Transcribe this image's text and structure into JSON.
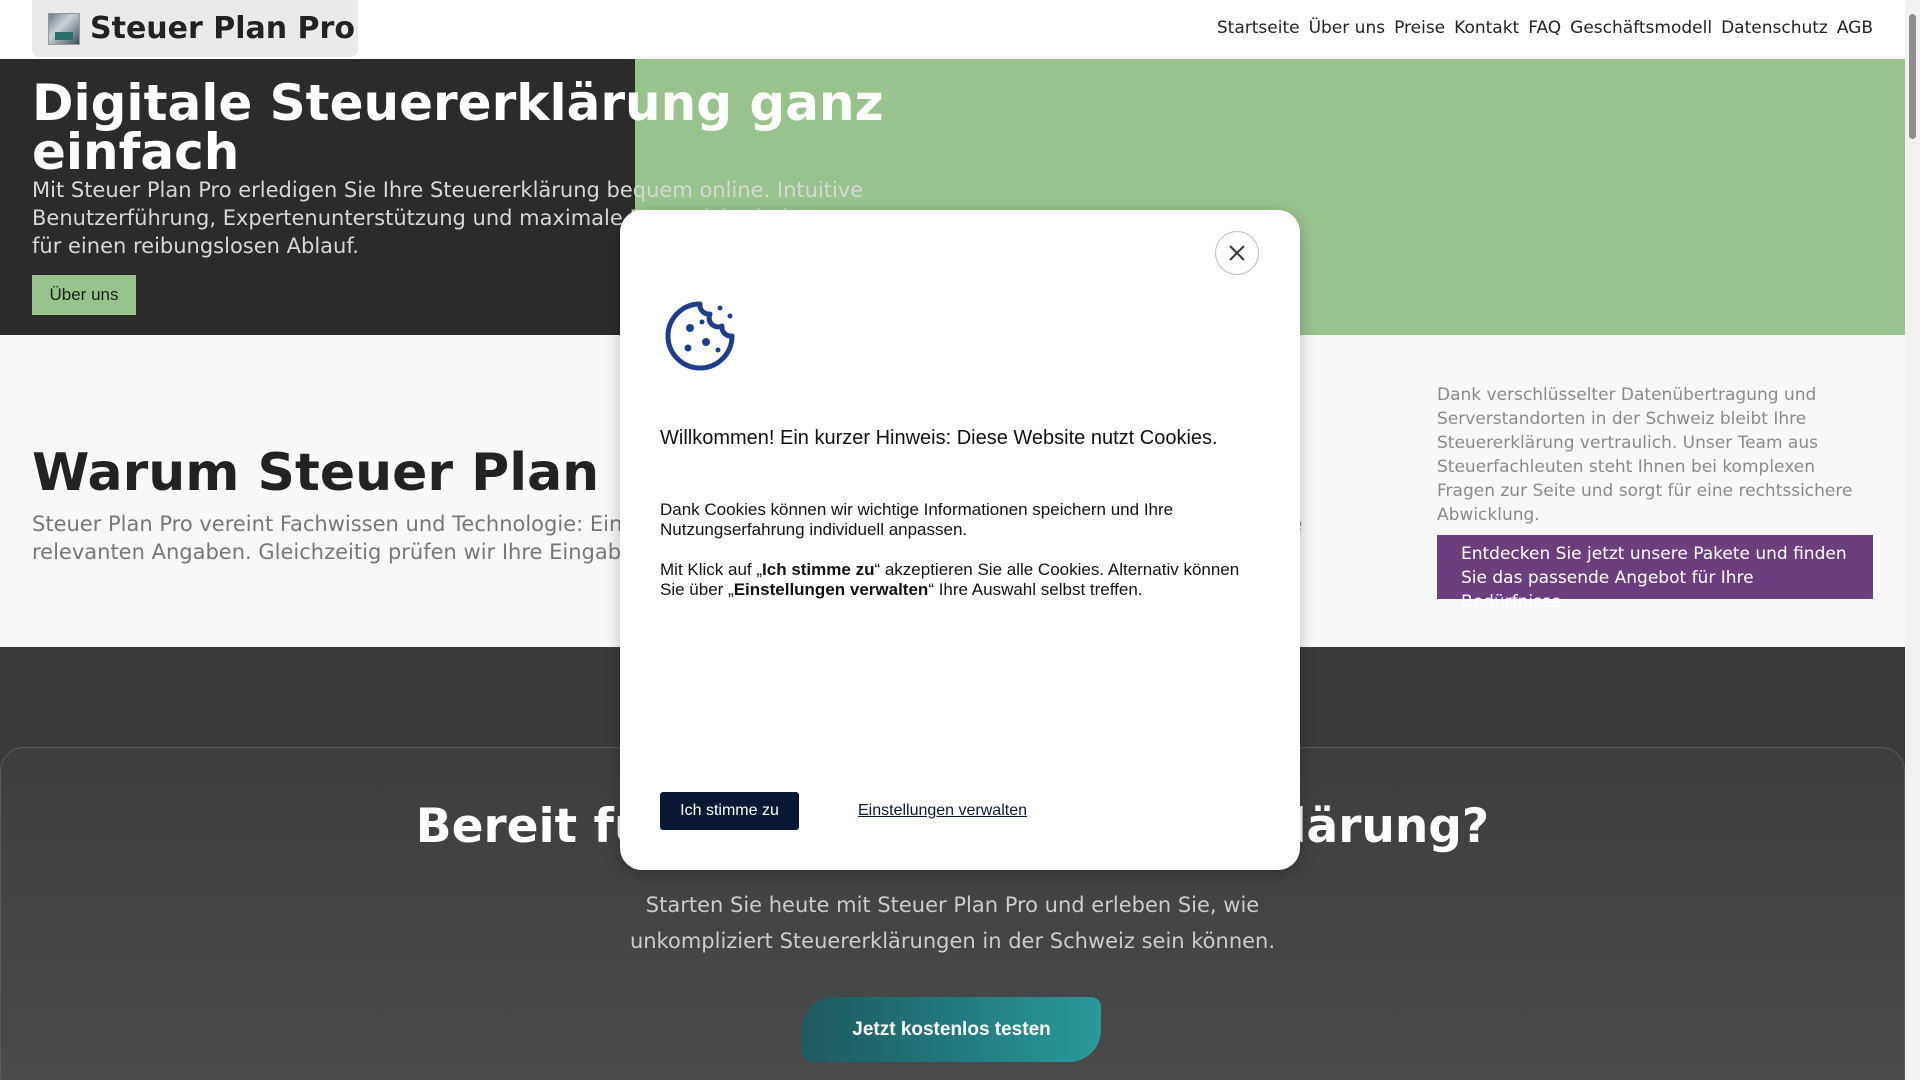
{
  "header": {
    "brand": "Steuer Plan Pro",
    "nav": [
      "Startseite",
      "Über uns",
      "Preise",
      "Kontakt",
      "FAQ",
      "Geschäftsmodell",
      "Datenschutz",
      "AGB"
    ]
  },
  "hero": {
    "title": "Digitale Steuererklärung ganz einfach",
    "text": "Mit Steuer Plan Pro erledigen Sie Ihre Steuererklärung bequem online. Intuitive Benutzerführung, Expertenunterstützung und maximale Datensicherheit sorgen für einen reibungslosen Ablauf.",
    "button": "Über uns"
  },
  "why": {
    "title": "Warum Steuer Plan Pro?",
    "text": "Steuer Plan Pro vereint Fachwissen und Technologie: Ein übersichtliches Dashboard führt Sie Schritt für Schritt durch alle relevanten Angaben. Gleichzeitig prüfen wir Ihre Eingaben auf Plausibilität.",
    "side_text": "Dank verschlüsselter Datenübertragung und Serverstandorten in der Schweiz bleibt Ihre Steuererklärung vertraulich. Unser Team aus Steuerfachleuten steht Ihnen bei komplexen Fragen zur Seite und sorgt für eine rechtssichere Abwicklung.",
    "cta": "Entdecken Sie jetzt unsere Pakete und finden Sie das passende Angebot für Ihre Bedürfnisse."
  },
  "bottom": {
    "title": "Bereit für Ihre digitale Steuererklärung?",
    "text": "Starten Sie heute mit Steuer Plan Pro und erleben Sie, wie unkompliziert Steuererklärungen in der Schweiz sein können.",
    "button": "Jetzt kostenlos testen"
  },
  "cookie": {
    "title": "Willkommen! Ein kurzer Hinweis: Diese Website nutzt Cookies.",
    "p1": "Dank Cookies können wir wichtige Informationen speichern und Ihre Nutzungserfahrung individuell anpassen.",
    "p2_a": "Mit Klick auf „",
    "p2_b": "Ich stimme zu",
    "p2_c": "“ akzeptieren Sie alle Cookies. Alternativ können Sie über „",
    "p2_d": "Einstellungen verwalten",
    "p2_e": "“ Ihre Auswahl selbst treffen.",
    "accept": "Ich stimme zu",
    "settings": "Einstellungen verwalten",
    "icon": "cookie-icon",
    "icon_color": "#1e3e8c"
  },
  "colors": {
    "hero_dark": "#2b2b2b",
    "accent_green": "#99c38c",
    "cta_purple": "#6b3f7d",
    "button_teal": "#237f82",
    "navy": "#0b1833"
  }
}
